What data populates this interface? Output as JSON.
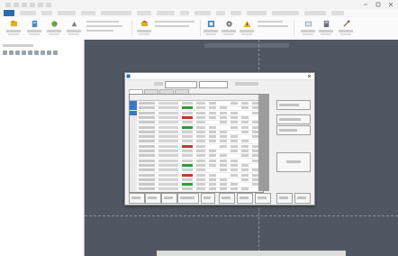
{
  "window": {
    "title": "",
    "file_tab_label": ""
  },
  "dialog": {
    "title": ""
  },
  "colors": {
    "accent": "#2b6cb0",
    "viewport_background": "#515762",
    "dialog_background": "#f0f0f0",
    "grid_selection": "#3b78c4",
    "status_green": "#2e9e3a",
    "status_red": "#c23b2e",
    "warning_yellow": "#e0b020"
  },
  "icons": {
    "window_controls": [
      "minimize-icon",
      "maximize-icon",
      "close-icon"
    ],
    "ribbon": [
      "warning-icon",
      "gear-icon"
    ],
    "dialog": [
      "close-icon"
    ]
  }
}
